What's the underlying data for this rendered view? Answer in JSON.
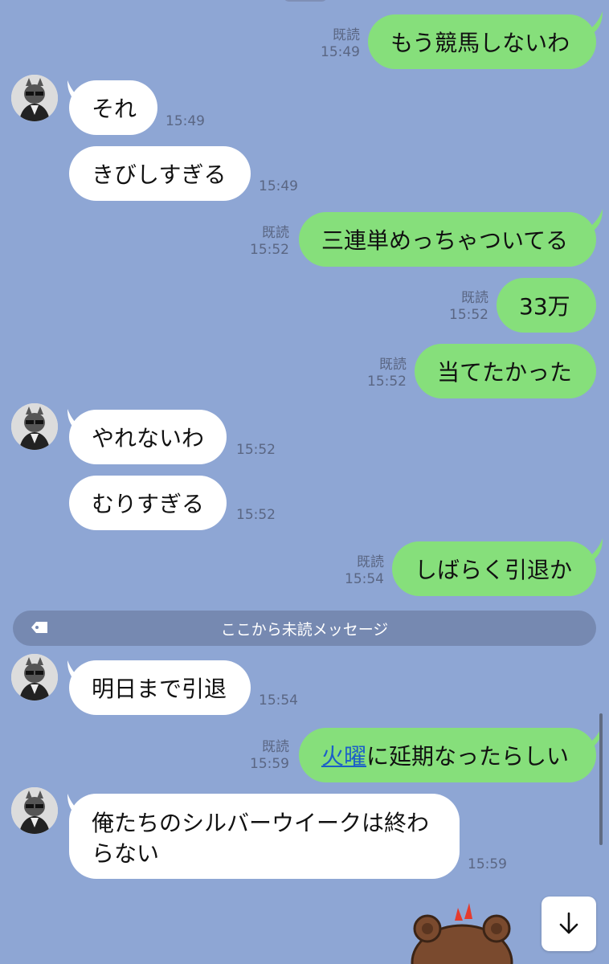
{
  "colors": {
    "background": "#8ea6d4",
    "sent_bubble": "#86df7b",
    "received_bubble": "#ffffff",
    "meta_text": "#5a6683",
    "divider_bg": "#7689b1",
    "link": "#1c5fc8"
  },
  "messages": [
    {
      "dir": "out",
      "text": "もう競馬しないわ",
      "read": "既読",
      "time": "15:49"
    },
    {
      "dir": "in",
      "text": "それ",
      "time": "15:49",
      "avatar": true
    },
    {
      "dir": "in",
      "text": "きびしすぎる",
      "time": "15:49"
    },
    {
      "dir": "out",
      "text": "三連単めっちゃついてる",
      "read": "既読",
      "time": "15:52"
    },
    {
      "dir": "out",
      "text": "33万",
      "read": "既読",
      "time": "15:52"
    },
    {
      "dir": "out",
      "text": "当てたかった",
      "read": "既読",
      "time": "15:52"
    },
    {
      "dir": "in",
      "text": "やれないわ",
      "time": "15:52",
      "avatar": true
    },
    {
      "dir": "in",
      "text": "むりすぎる",
      "time": "15:52"
    },
    {
      "dir": "out",
      "text": "しばらく引退か",
      "read": "既読",
      "time": "15:54"
    },
    {
      "dir": "in",
      "text": "明日まで引退",
      "time": "15:54",
      "avatar": true
    },
    {
      "dir": "out",
      "link_text": "火曜",
      "text": "に延期なったらしい",
      "read": "既読",
      "time": "15:59"
    },
    {
      "dir": "in",
      "text": "俺たちのシルバーウイークは終わらない",
      "time": "15:59",
      "avatar": true
    }
  ],
  "unread_divider": {
    "label": "ここから未読メッセージ",
    "icon": "tag-icon"
  },
  "scroll_down_icon": "arrow-down-icon",
  "sticker_icon": "bear-sticker-icon"
}
